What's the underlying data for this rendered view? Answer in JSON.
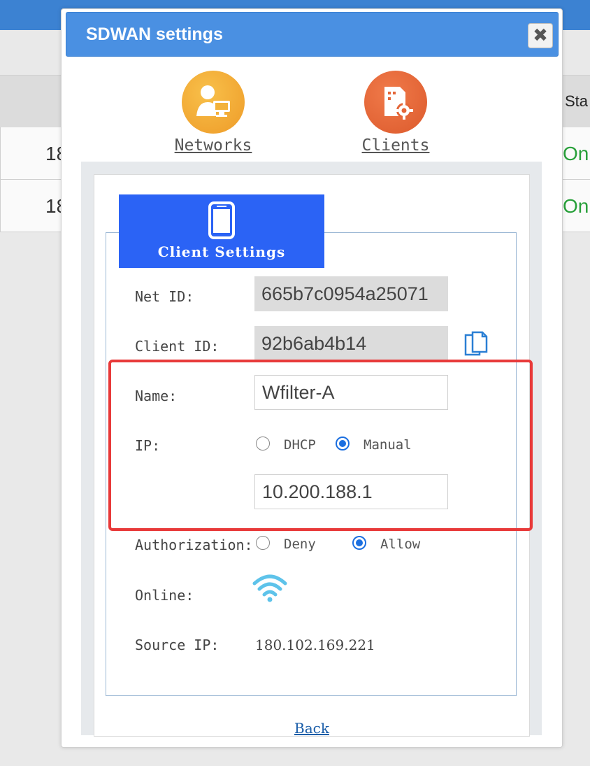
{
  "background": {
    "table_rows": [
      {
        "id_prefix": "18",
        "status": "On"
      },
      {
        "id_prefix": "18",
        "status": "On"
      }
    ],
    "status_header": "Sta"
  },
  "dialog": {
    "title": "SDWAN settings",
    "close_icon": "close-x-icon"
  },
  "nav": {
    "networks_label": "Networks",
    "clients_label": "Clients"
  },
  "tab": {
    "label": "Client Settings",
    "icon": "mobile-phone-icon"
  },
  "form": {
    "net_id_label": "Net ID:",
    "net_id_value": "665b7c0954a25071",
    "client_id_label": "Client ID:",
    "client_id_value": "92b6ab4b14",
    "name_label": "Name:",
    "name_value": "Wfilter-A",
    "ip_label": "IP:",
    "ip_options": [
      "DHCP",
      "Manual"
    ],
    "ip_selected": "Manual",
    "ip_value": "10.200.188.1",
    "authorization_label": "Authorization:",
    "auth_options": [
      "Deny",
      "Allow"
    ],
    "auth_selected": "Allow",
    "online_label": "Online:",
    "source_ip_label": "Source IP:",
    "source_ip_value": "180.102.169.221"
  },
  "back_label": "Back",
  "colors": {
    "titlebar": "#4a90e2",
    "tab": "#2b63f5",
    "highlight": "#e83a3a",
    "online_green": "#28a03a",
    "wifi": "#5ec3ea"
  }
}
